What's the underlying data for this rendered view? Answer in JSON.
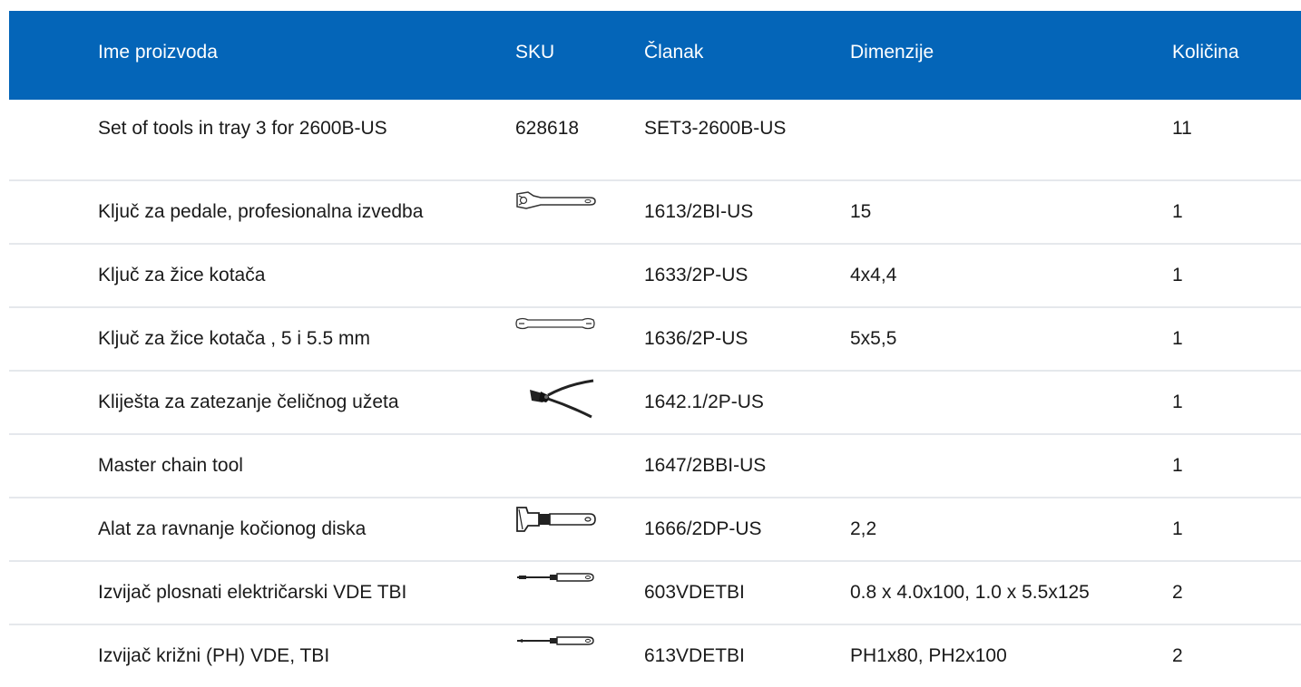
{
  "header": {
    "name": "Ime proizvoda",
    "sku": "SKU",
    "article": "Članak",
    "dimensions": "Dimenzije",
    "quantity": "Količina"
  },
  "rows": [
    {
      "name": "Set of tools in tray 3 for 2600B-US",
      "sku": "628618",
      "article": "SET3-2600B-US",
      "dimensions": "",
      "quantity": "11",
      "image": ""
    },
    {
      "name": "Ključ za pedale, profesionalna izvedba",
      "sku": "",
      "article": "1613/2BI-US",
      "dimensions": "15",
      "quantity": "1",
      "image": "pedal-wrench-icon"
    },
    {
      "name": "Ključ za žice kotača",
      "sku": "",
      "article": "1633/2P-US",
      "dimensions": "4x4,4",
      "quantity": "1",
      "image": ""
    },
    {
      "name": "Ključ za žice kotača , 5 i 5.5 mm",
      "sku": "",
      "article": "1636/2P-US",
      "dimensions": "5x5,5",
      "quantity": "1",
      "image": "spoke-wrench-icon"
    },
    {
      "name": "Kliješta za zatezanje čeličnog užeta",
      "sku": "",
      "article": "1642.1/2P-US",
      "dimensions": "",
      "quantity": "1",
      "image": "cable-pliers-icon"
    },
    {
      "name": "Master chain tool",
      "sku": "",
      "article": "1647/2BBI-US",
      "dimensions": "",
      "quantity": "1",
      "image": ""
    },
    {
      "name": "Alat za ravnanje kočionog diska",
      "sku": "",
      "article": "1666/2DP-US",
      "dimensions": "2,2",
      "quantity": "1",
      "image": "rotor-truing-tool-icon"
    },
    {
      "name": "Izvijač plosnati električarski VDE TBI",
      "sku": "",
      "article": "603VDETBI",
      "dimensions": "0.8 x 4.0x100, 1.0 x 5.5x125",
      "quantity": "2",
      "image": "flat-screwdriver-icon"
    },
    {
      "name": "Izvijač križni (PH) VDE, TBI",
      "sku": "",
      "article": "613VDETBI",
      "dimensions": "PH1x80, PH2x100",
      "quantity": "2",
      "image": "phillips-screwdriver-icon"
    }
  ],
  "colors": {
    "header_bg": "#0465b8",
    "header_text": "#ffffff",
    "row_divider": "#e5e8ec"
  }
}
